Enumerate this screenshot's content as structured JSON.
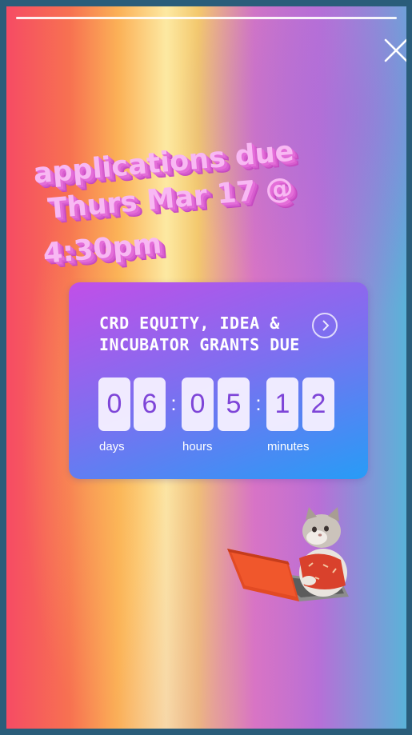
{
  "headline": {
    "line1": "applications due",
    "line2": "Thurs Mar 17 @",
    "line3": "4:30pm"
  },
  "countdown": {
    "title": "CRD EQUITY, IDEA &\nINCUBATOR GRANTS DUE",
    "digits": [
      "0",
      "6",
      "0",
      "5",
      "1",
      "2"
    ],
    "separator": ":",
    "units": [
      "days",
      "hours",
      "minutes"
    ]
  },
  "icons": {
    "close": "close-icon",
    "chevron": "chevron-right-icon",
    "sticker": "cat-with-laptop-sticker"
  }
}
